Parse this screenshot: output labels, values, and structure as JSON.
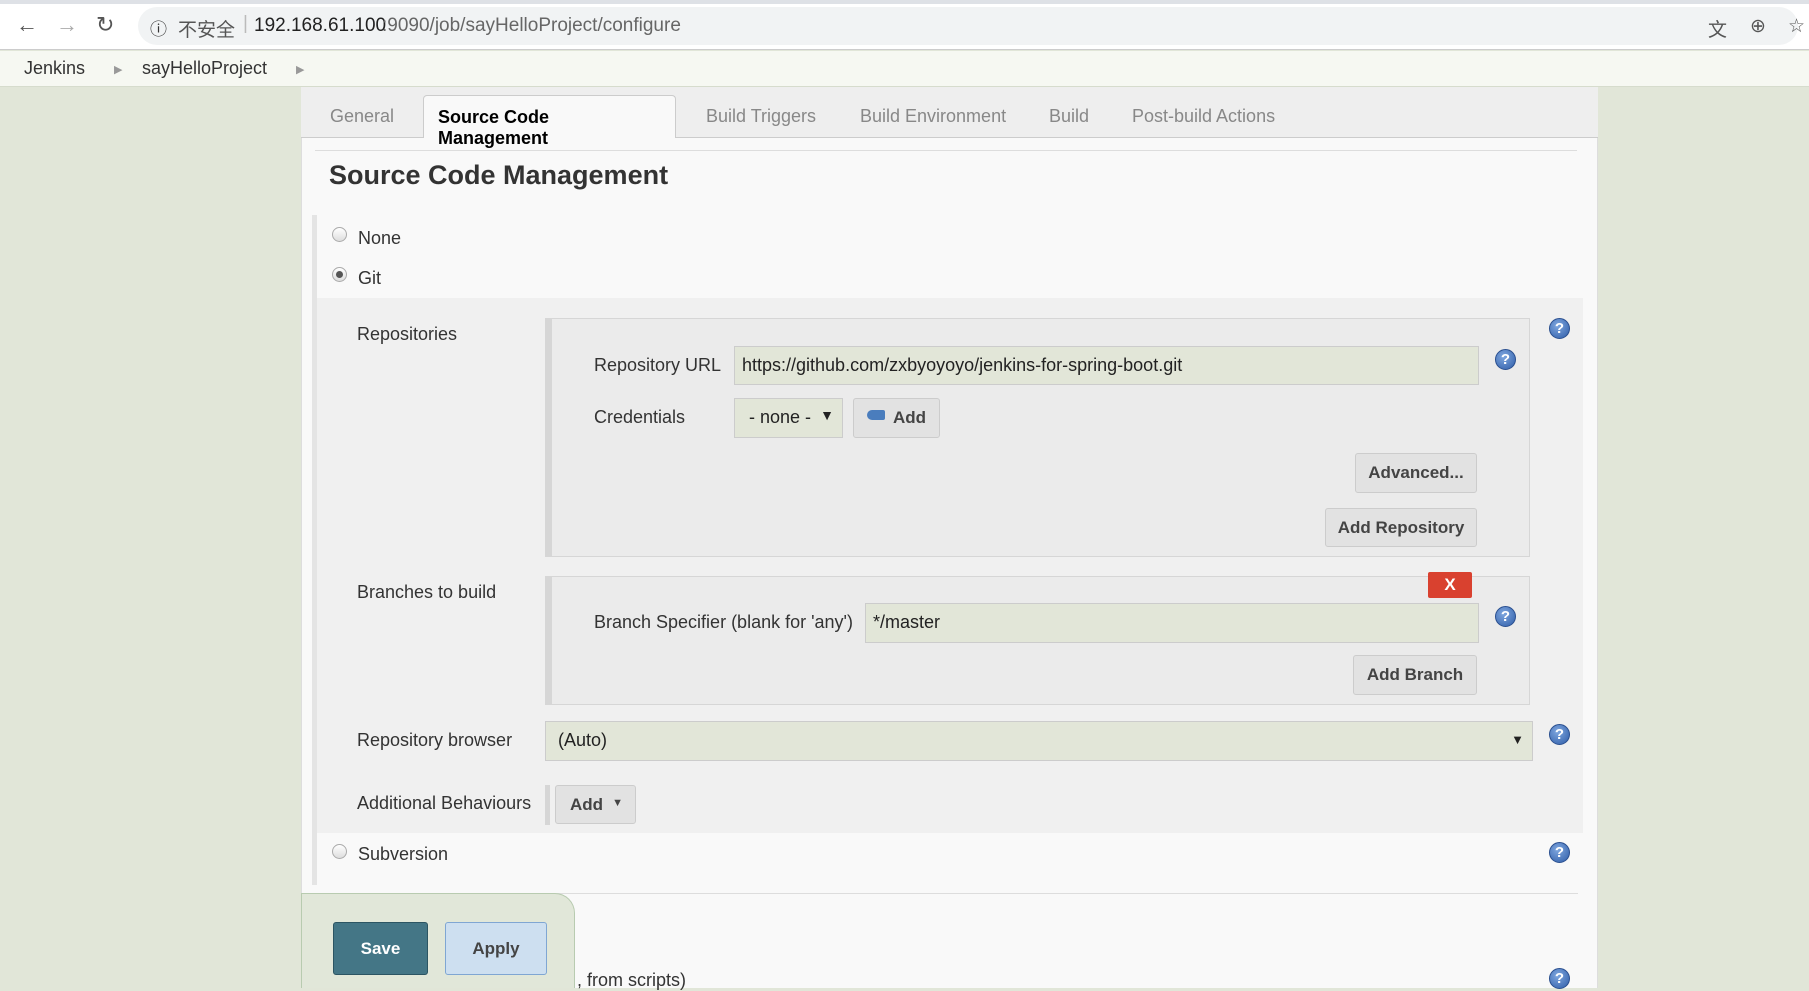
{
  "browser": {
    "security_label": "不安全",
    "url_host": "192.168.61.100",
    "url_rest": ":9090/job/sayHelloProject/configure"
  },
  "breadcrumb": [
    "Jenkins",
    "sayHelloProject"
  ],
  "tabs": [
    "General",
    "Source Code Management",
    "Build Triggers",
    "Build Environment",
    "Build",
    "Post-build Actions"
  ],
  "active_tab": "Source Code Management",
  "section_title": "Source Code Management",
  "scm_options": {
    "none": "None",
    "git": "Git",
    "subversion": "Subversion",
    "selected": "Git"
  },
  "repositories": {
    "label": "Repositories",
    "url_label": "Repository URL",
    "url_value": "https://github.com/zxbyoyoyo/jenkins-for-spring-boot.git",
    "credentials_label": "Credentials",
    "credentials_value": "- none -",
    "add_label": "Add",
    "advanced_label": "Advanced...",
    "add_repository_label": "Add Repository"
  },
  "branches": {
    "label": "Branches to build",
    "delete_label": "X",
    "specifier_label": "Branch Specifier (blank for 'any')",
    "specifier_value": "*/master",
    "add_branch_label": "Add Branch"
  },
  "repo_browser": {
    "label": "Repository browser",
    "value": "(Auto)"
  },
  "behaviours": {
    "label": "Additional Behaviours",
    "add_label": "Add"
  },
  "footer": {
    "save": "Save",
    "apply": "Apply",
    "partial_text": ", from scripts)"
  },
  "colors": {
    "save": "#447686",
    "apply": "#cddff0",
    "delete": "#d9412f",
    "background": "#e1e6d8"
  }
}
